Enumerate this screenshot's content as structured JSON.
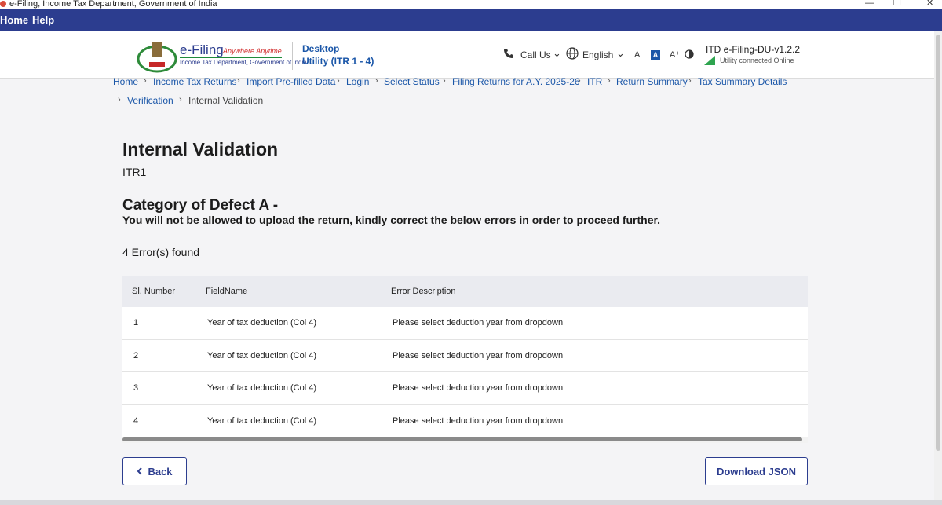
{
  "window": {
    "title": "e-Filing, Income Tax Department, Government of India",
    "minimize": "—",
    "restore": "❐",
    "close": "✕"
  },
  "navbar": {
    "items": [
      "Home",
      "Help"
    ]
  },
  "header": {
    "logo_main": "e-Filing",
    "logo_tagline": "Anywhere Anytime",
    "logo_sub": "Income Tax Department, Government of India",
    "utility_line1": "Desktop",
    "utility_line2": "Utility (ITR 1 - 4)",
    "call_us": "Call Us",
    "language": "English",
    "font_decrease": "A⁻",
    "font_normal": "A",
    "font_increase": "A⁺",
    "version": "ITD e-Filing-DU-v1.2.2",
    "status": "Utility connected Online"
  },
  "breadcrumb": {
    "items": [
      "Home",
      "Income Tax Returns",
      "Import Pre-filled Data",
      "Login",
      "Select Status",
      "Filing Returns for A.Y. 2025-26",
      "ITR",
      "Return Summary",
      "Tax Summary Details",
      "Verification"
    ],
    "current": "Internal Validation"
  },
  "page": {
    "title": "Internal Validation",
    "subtitle": "ITR1",
    "category_title": "Category of Defect A -",
    "category_desc": "You will not be allowed to upload the return, kindly correct the below errors in order to proceed further.",
    "error_count": "4 Error(s) found"
  },
  "table": {
    "headers": [
      "Sl. Number",
      "FieldName",
      "Error Description"
    ],
    "rows": [
      [
        "1",
        "Year of tax deduction (Col 4)",
        "Please select deduction year from dropdown"
      ],
      [
        "2",
        "Year of tax deduction (Col 4)",
        "Please select deduction year from dropdown"
      ],
      [
        "3",
        "Year of tax deduction (Col 4)",
        "Please select deduction year from dropdown"
      ],
      [
        "4",
        "Year of tax deduction (Col 4)",
        "Please select deduction year from dropdown"
      ]
    ]
  },
  "buttons": {
    "back": "Back",
    "download": "Download JSON"
  },
  "icons": {
    "back": "chevron-left-icon",
    "phone": "phone-icon",
    "globe": "globe-icon",
    "contrast": "contrast-icon"
  },
  "colors": {
    "navbar": "#2c3d8f",
    "link": "#1a56a8",
    "status_online": "#2ea44f"
  }
}
